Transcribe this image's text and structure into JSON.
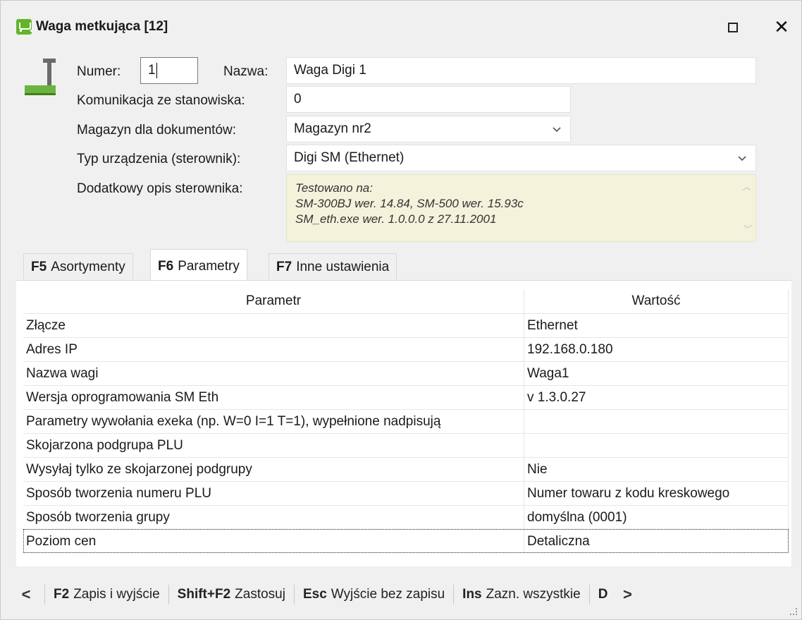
{
  "window": {
    "title": "Waga metkująca [12]",
    "maximize_label": "",
    "close_label": "✕"
  },
  "form": {
    "numer_label": "Numer:",
    "numer_value": "1",
    "nazwa_label": "Nazwa:",
    "nazwa_value": "Waga Digi 1",
    "komunikacja_label": "Komunikacja ze stanowiska:",
    "komunikacja_value": "0",
    "magazyn_label": "Magazyn dla dokumentów:",
    "magazyn_value": "Magazyn nr2",
    "typ_label": "Typ urządzenia (sterownik):",
    "typ_value": "Digi SM (Ethernet)",
    "opis_label": "Dodatkowy opis sterownika:",
    "opis_lines": [
      "Testowano na:",
      "SM-300BJ wer. 14.84, SM-500 wer. 15.93c",
      "SM_eth.exe wer. 1.0.0.0 z 27.11.2001"
    ]
  },
  "tabs": [
    {
      "key": "F5",
      "label": "Asortymenty"
    },
    {
      "key": "F6",
      "label": "Parametry"
    },
    {
      "key": "F7",
      "label": "Inne ustawienia"
    }
  ],
  "active_tab": "F6",
  "table": {
    "headers": [
      "Parametr",
      "Wartość"
    ],
    "rows": [
      [
        "Złącze",
        "Ethernet"
      ],
      [
        "Adres IP",
        "192.168.0.180"
      ],
      [
        "Nazwa wagi",
        "Waga1"
      ],
      [
        "Wersja oprogramowania SM Eth",
        "v 1.3.0.27"
      ],
      [
        "Parametry wywołania exeka (np. W=0 I=1 T=1), wypełnione nadpisują",
        ""
      ],
      [
        "Skojarzona podgrupa PLU",
        ""
      ],
      [
        "Wysyłaj tylko ze skojarzonej podgrupy",
        "Nie"
      ],
      [
        "Sposób tworzenia numeru PLU",
        "Numer towaru z kodu kreskowego"
      ],
      [
        "Sposób tworzenia grupy",
        "domyślna (0001)"
      ],
      [
        "Poziom cen",
        "Detaliczna"
      ]
    ]
  },
  "toolbar": {
    "prev": "<",
    "next": ">",
    "items": [
      {
        "key": "F2",
        "label": "Zapis i wyjście"
      },
      {
        "key": "Shift+F2",
        "label": "Zastosuj"
      },
      {
        "key": "Esc",
        "label": "Wyjście bez zapisu"
      },
      {
        "key": "Ins",
        "label": "Zazn. wszystkie"
      },
      {
        "key": "D",
        "label": ""
      }
    ]
  },
  "colors": {
    "accent_green": "#62b52a",
    "description_bg": "#f5f2dc"
  }
}
